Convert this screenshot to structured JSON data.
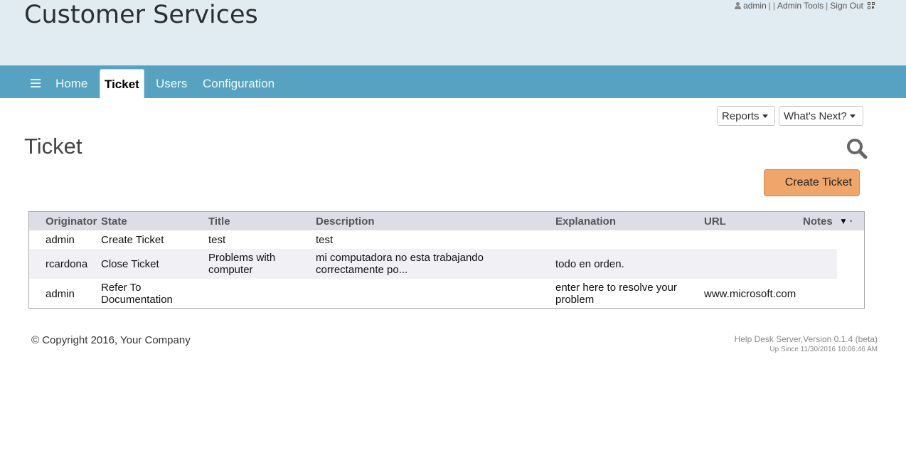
{
  "header": {
    "site_title": "Customer Services",
    "user": "admin",
    "separators": [
      "|",
      "|",
      "|"
    ],
    "admin_tools": "Admin Tools",
    "sign_out": "Sign Out"
  },
  "nav": {
    "items": [
      {
        "label": "Home"
      },
      {
        "label": "Ticket"
      },
      {
        "label": "Users"
      },
      {
        "label": "Configuration"
      }
    ],
    "active": "Ticket"
  },
  "toolbar": {
    "reports_label": "Reports",
    "whats_next_label": "What's Next?"
  },
  "page": {
    "title": "Ticket",
    "create_label": "Create Ticket"
  },
  "table": {
    "columns": [
      "Originator",
      "State",
      "Title",
      "Description",
      "Explanation",
      "URL",
      "Notes"
    ],
    "menu_glyph": "▼",
    "rows": [
      {
        "originator": "admin",
        "state": "Create Ticket",
        "title": "test",
        "description": "test",
        "explanation": "",
        "url": "",
        "notes": ""
      },
      {
        "originator": "rcardona",
        "state": "Close Ticket",
        "title_lines": [
          "Problems with",
          "computer"
        ],
        "description_lines": [
          "mi computadora no esta trabajando",
          "correctamente po..."
        ],
        "explanation": "todo en orden.",
        "url": "",
        "notes": ""
      },
      {
        "originator": "admin",
        "state_lines": [
          "Refer To",
          "Documentation"
        ],
        "title": "",
        "description": "",
        "explanation_lines": [
          "enter here to resolve your",
          "problem"
        ],
        "url": "www.microsoft.com",
        "notes": ""
      }
    ]
  },
  "footer": {
    "copyright": "© Copyright 2016, Your Company",
    "version": "Help Desk Server,Version 0.1.4 (beta)",
    "uptime": "Up Since 11/30/2016 10:06:46 AM"
  },
  "colors": {
    "header_bg": "#e1ecf2",
    "nav_bg": "#57a2c0",
    "create_button": "#f0a56a",
    "grid_header": "#dddde7"
  },
  "icons": [
    "person-icon",
    "qr-code-icon",
    "hamburger-menu-icon",
    "search-icon",
    "caret-down-icon"
  ]
}
